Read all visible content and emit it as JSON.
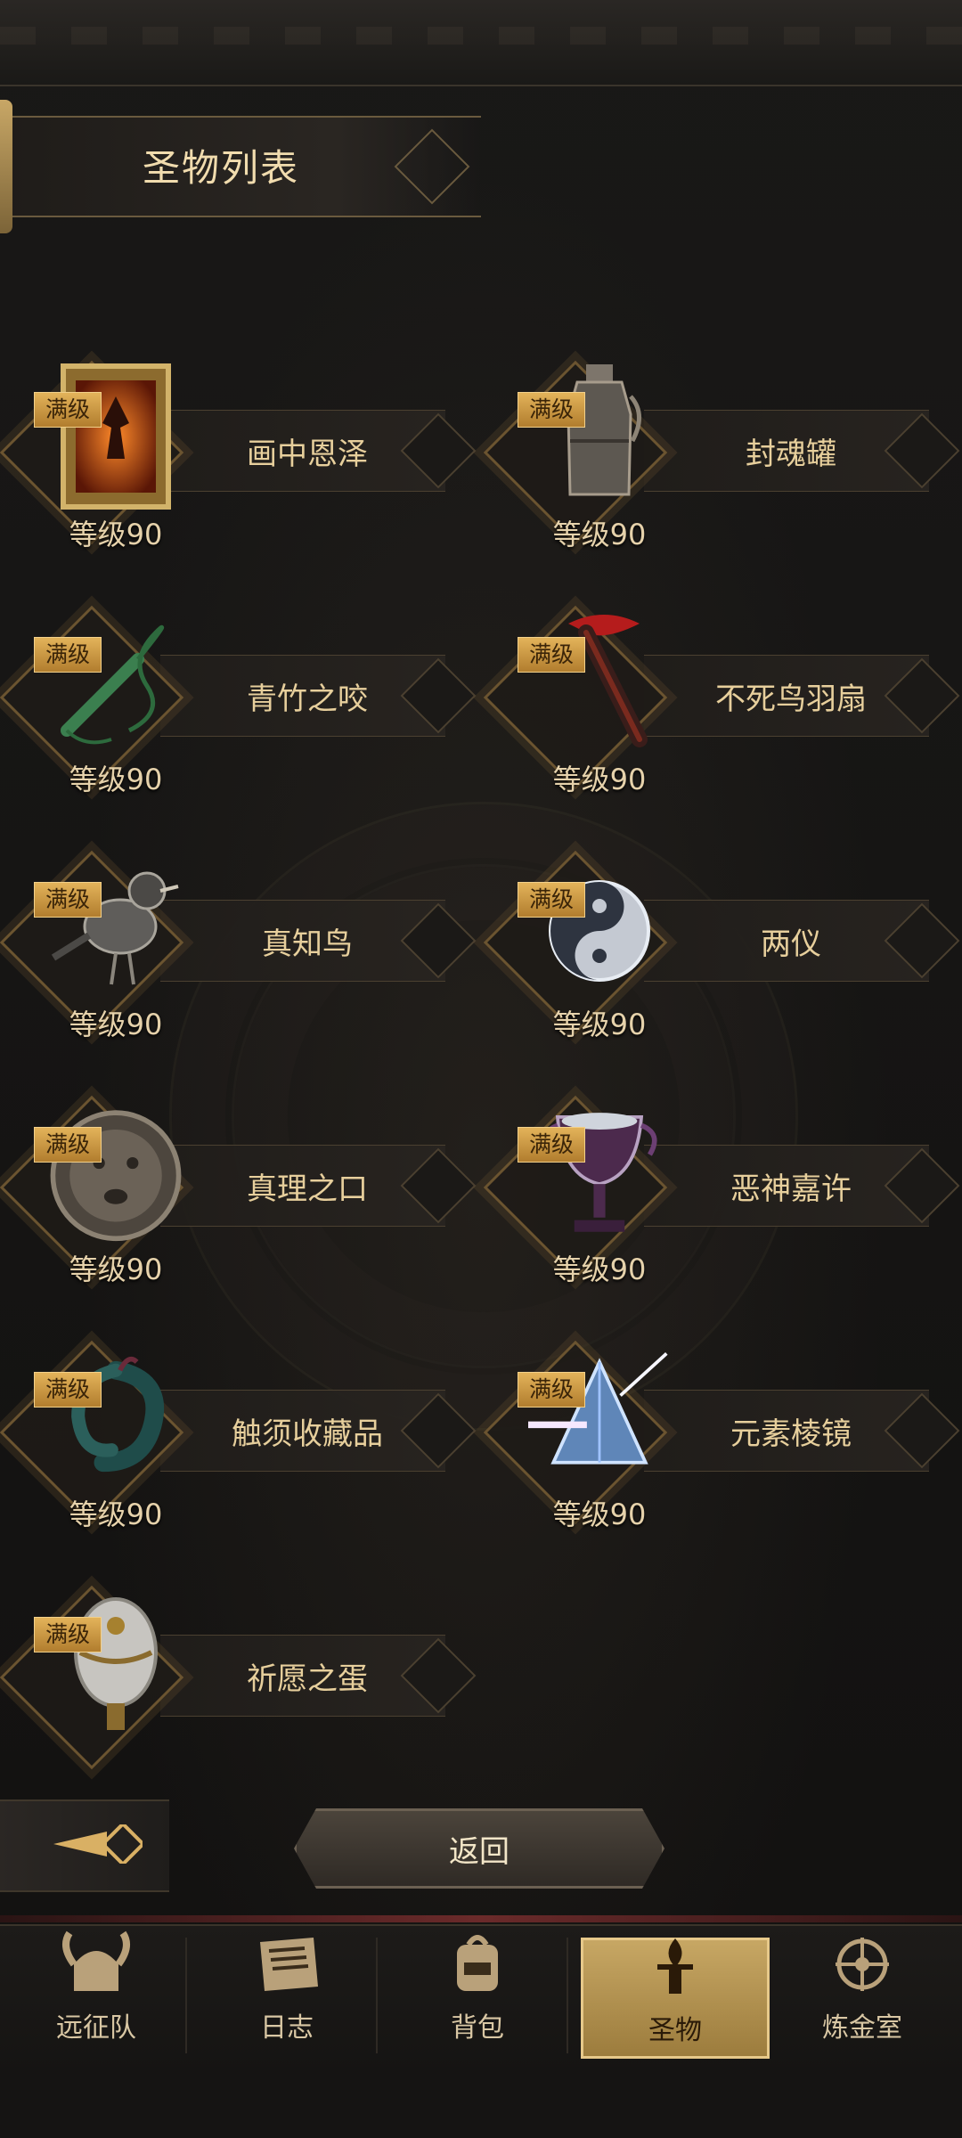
{
  "header": {
    "title": "圣物列表"
  },
  "relics": [
    {
      "name": "画中恩泽",
      "level": "等级90",
      "badge": "满级",
      "icon": "framed-painting-icon"
    },
    {
      "name": "封魂罐",
      "level": "等级90",
      "badge": "满级",
      "icon": "soul-jar-icon"
    },
    {
      "name": "青竹之咬",
      "level": "等级90",
      "badge": "满级",
      "icon": "green-whip-icon"
    },
    {
      "name": "不死鸟羽扇",
      "level": "等级90",
      "badge": "满级",
      "icon": "phoenix-feather-fan-icon"
    },
    {
      "name": "真知鸟",
      "level": "等级90",
      "badge": "满级",
      "icon": "mechanical-bird-icon"
    },
    {
      "name": "两仪",
      "level": "等级90",
      "badge": "满级",
      "icon": "yin-yang-ornament-icon"
    },
    {
      "name": "真理之口",
      "level": "等级90",
      "badge": "满级",
      "icon": "stone-face-icon"
    },
    {
      "name": "恶神嘉许",
      "level": "等级90",
      "badge": "满级",
      "icon": "dark-chalice-icon"
    },
    {
      "name": "触须收藏品",
      "level": "等级90",
      "badge": "满级",
      "icon": "tentacle-relic-icon"
    },
    {
      "name": "元素棱镜",
      "level": "等级90",
      "badge": "满级",
      "icon": "prism-icon"
    },
    {
      "name": "祈愿之蛋",
      "level": "",
      "badge": "满级",
      "icon": "ornate-egg-icon"
    }
  ],
  "footer": {
    "return_label": "返回"
  },
  "nav": [
    {
      "label": "远征队",
      "icon": "horned-helmet-icon"
    },
    {
      "label": "日志",
      "icon": "scroll-icon"
    },
    {
      "label": "背包",
      "icon": "backpack-icon"
    },
    {
      "label": "圣物",
      "icon": "torch-relic-icon",
      "active": true
    },
    {
      "label": "炼金室",
      "icon": "alchemy-icon"
    }
  ],
  "colors": {
    "accent": "#c7a764",
    "badge": "#d29a43",
    "text": "#e7cf9c"
  }
}
